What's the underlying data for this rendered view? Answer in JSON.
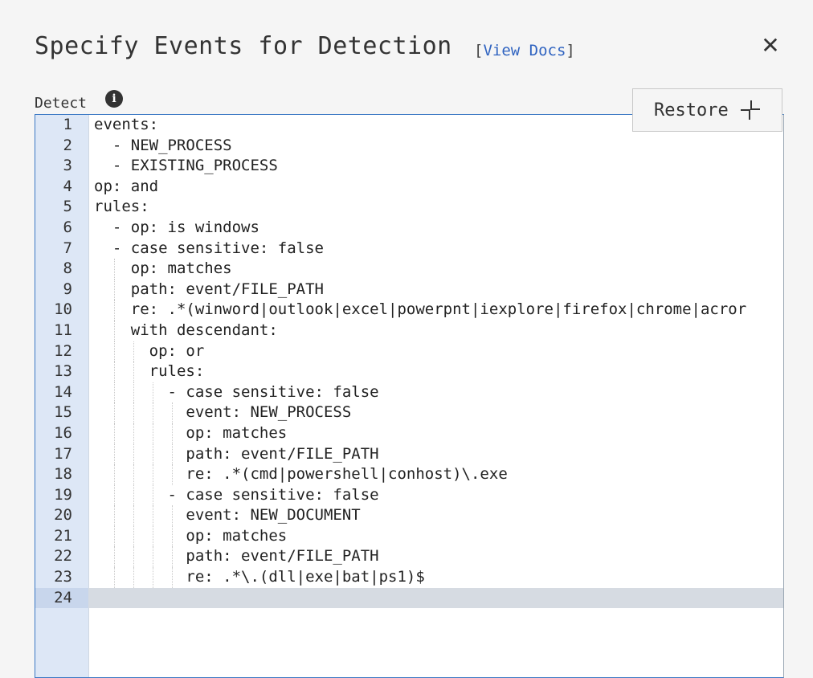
{
  "dialog": {
    "title": "Specify Events for Detection",
    "docs_open": "[",
    "docs_link": "View Docs",
    "docs_close": "]",
    "close_glyph": "✕"
  },
  "field": {
    "label": "Detect",
    "info_glyph": "i"
  },
  "restore_button": {
    "label": "Restore"
  },
  "editor": {
    "active_line": 24,
    "lines": [
      {
        "n": "1",
        "indent": 0,
        "text": "events:"
      },
      {
        "n": "2",
        "indent": 0,
        "text": "  - NEW_PROCESS"
      },
      {
        "n": "3",
        "indent": 0,
        "text": "  - EXISTING_PROCESS"
      },
      {
        "n": "4",
        "indent": 0,
        "text": "op: and"
      },
      {
        "n": "5",
        "indent": 0,
        "text": "rules:"
      },
      {
        "n": "6",
        "indent": 0,
        "text": "  - op: is windows"
      },
      {
        "n": "7",
        "indent": 0,
        "text": "  - case sensitive: false"
      },
      {
        "n": "8",
        "indent": 1,
        "text": "    op: matches"
      },
      {
        "n": "9",
        "indent": 1,
        "text": "    path: event/FILE_PATH"
      },
      {
        "n": "10",
        "indent": 1,
        "text": "    re: .*(winword|outlook|excel|powerpnt|iexplore|firefox|chrome|acror"
      },
      {
        "n": "11",
        "indent": 1,
        "text": "    with descendant:"
      },
      {
        "n": "12",
        "indent": 2,
        "text": "      op: or"
      },
      {
        "n": "13",
        "indent": 2,
        "text": "      rules:"
      },
      {
        "n": "14",
        "indent": 3,
        "text": "        - case sensitive: false"
      },
      {
        "n": "15",
        "indent": 4,
        "text": "          event: NEW_PROCESS"
      },
      {
        "n": "16",
        "indent": 4,
        "text": "          op: matches"
      },
      {
        "n": "17",
        "indent": 4,
        "text": "          path: event/FILE_PATH"
      },
      {
        "n": "18",
        "indent": 4,
        "text": "          re: .*(cmd|powershell|conhost)\\.exe"
      },
      {
        "n": "19",
        "indent": 3,
        "text": "        - case sensitive: false"
      },
      {
        "n": "20",
        "indent": 4,
        "text": "          event: NEW_DOCUMENT"
      },
      {
        "n": "21",
        "indent": 4,
        "text": "          op: matches"
      },
      {
        "n": "22",
        "indent": 4,
        "text": "          path: event/FILE_PATH"
      },
      {
        "n": "23",
        "indent": 4,
        "text": "          re: .*\\.(dll|exe|bat|ps1)$"
      },
      {
        "n": "24",
        "indent": 0,
        "text": ""
      }
    ]
  }
}
